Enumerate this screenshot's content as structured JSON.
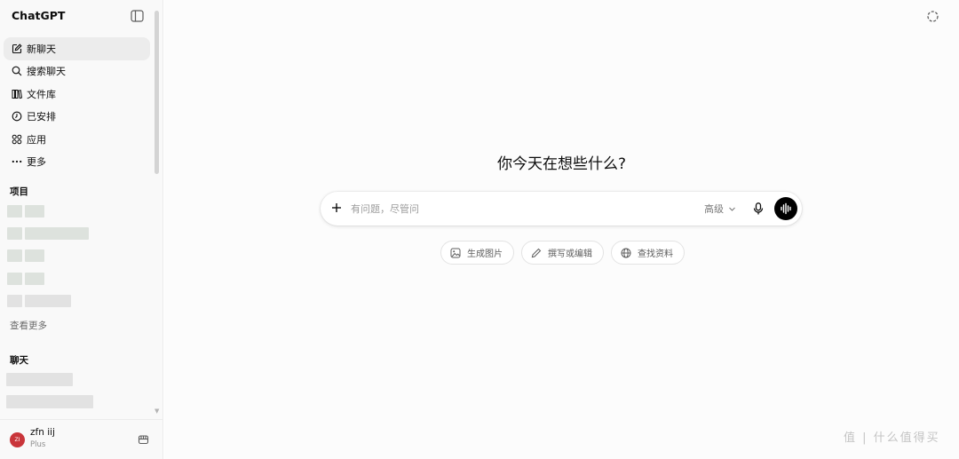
{
  "sidebar": {
    "brand": "ChatGPT",
    "nav": [
      {
        "label": "新聊天",
        "icon": "new-chat-icon"
      },
      {
        "label": "搜索聊天",
        "icon": "search-icon"
      },
      {
        "label": "文件库",
        "icon": "library-icon"
      },
      {
        "label": "已安排",
        "icon": "clock-icon"
      },
      {
        "label": "应用",
        "icon": "apps-icon"
      },
      {
        "label": "更多",
        "icon": "more-icon"
      }
    ],
    "projects_heading": "项目",
    "see_more": "查看更多",
    "chats_heading": "聊天"
  },
  "user": {
    "avatar_initials": "ZI",
    "name": "zfn iij",
    "plan": "Plus"
  },
  "main": {
    "headline": "你今天在想些什么?",
    "composer": {
      "placeholder": "有问题，尽管问",
      "model_label": "高级"
    },
    "suggestions": [
      {
        "label": "生成图片",
        "icon": "image-icon"
      },
      {
        "label": "撰写或编辑",
        "icon": "pencil-icon"
      },
      {
        "label": "查找资料",
        "icon": "globe-icon"
      }
    ]
  },
  "watermark": "值 | 什么值得买"
}
